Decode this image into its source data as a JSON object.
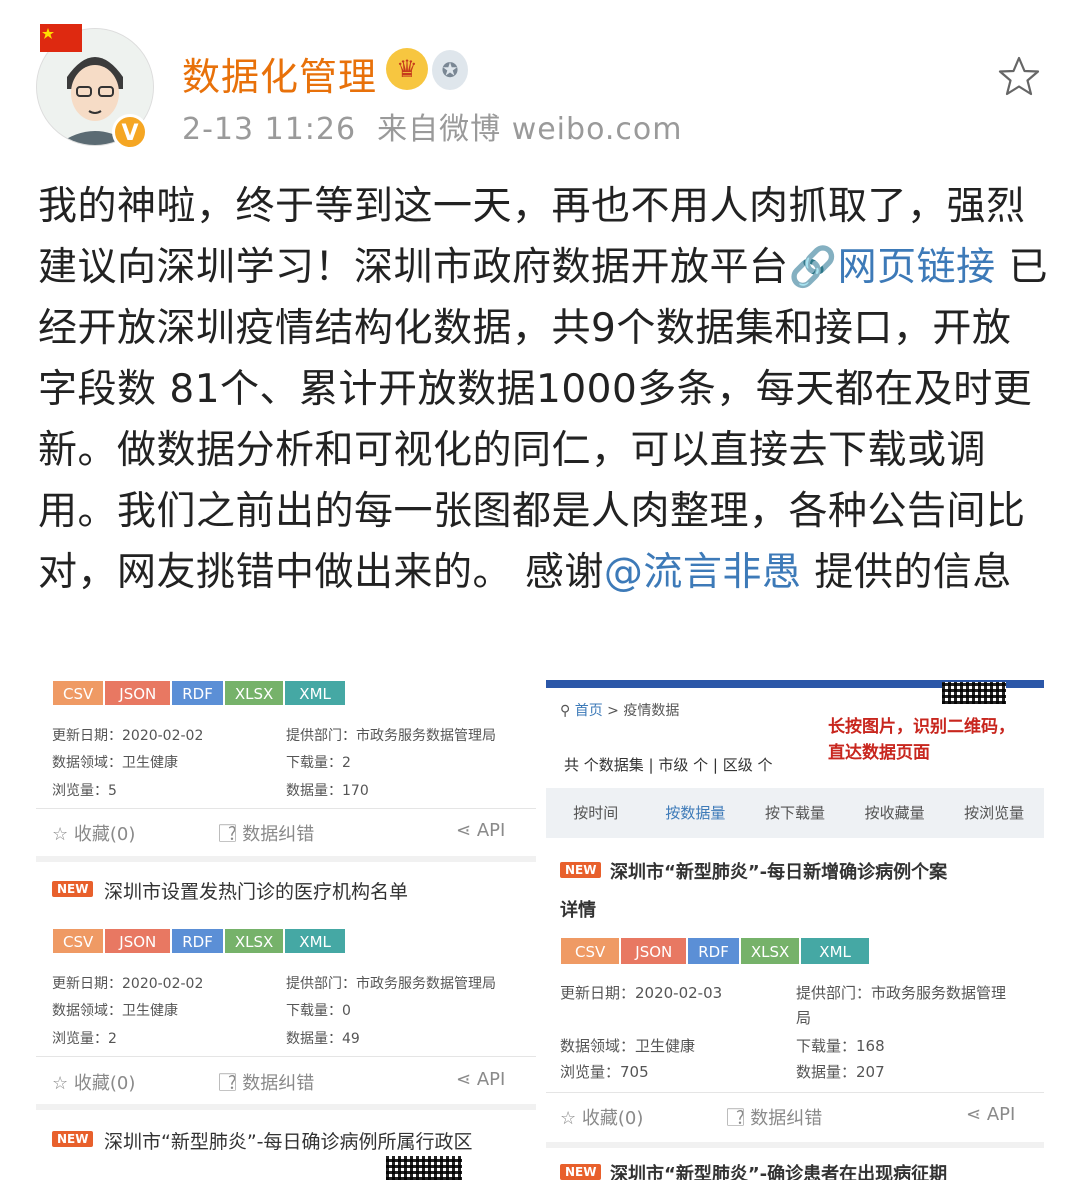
{
  "header": {
    "username": "数据化管理",
    "time": "2-13 11:26",
    "source": "来自微博 weibo.com",
    "verified_badge": "V"
  },
  "post": {
    "text1": "我的神啦，终于等到这一天，再也不用人肉抓取了，强烈建议向深圳学习！深圳市政府数据开放平台",
    "link1": "网页链接",
    "text2": " 已经开放深圳疫情结构化数据，共9个数据集和接口，开放字段数 81个、累计开放数据1000多条，每天都在及时更新。做数据分析和可视化的同仁，可以直接去下载或调用。我们之前出的每一张图都是人肉整理，各种公告间比对，网友挑错中做出来的。 感谢",
    "mention": "@流言非愚",
    "text3": " 提供的信息"
  },
  "left_image": {
    "formats": [
      "CSV",
      "JSON",
      "RDF",
      "XLSX",
      "XML"
    ],
    "card1": {
      "updated": "更新日期：2020-02-02",
      "dept": "提供部门：市政务服务数据管理局",
      "domain": "数据领域：卫生健康",
      "downloads": "下载量：2",
      "views": "浏览量：5",
      "records": "数据量：170"
    },
    "actions": {
      "fav": "收藏(0)",
      "report": "数据纠错",
      "api": "API"
    },
    "new": "NEW",
    "card2_title": "深圳市设置发热门诊的医疗机构名单",
    "card2": {
      "updated": "更新日期：2020-02-02",
      "dept": "提供部门：市政务服务数据管理局",
      "domain": "数据领域：卫生健康",
      "downloads": "下载量：0",
      "views": "浏览量：2",
      "records": "数据量：49"
    },
    "card3_title": "深圳市“新型肺炎”-每日确诊病例所属行政区"
  },
  "right_image": {
    "breadcrumb_home": "首页",
    "breadcrumb_sep": ">",
    "breadcrumb_page": "疫情数据",
    "qr_note_line1": "长按图片，识别二维码，",
    "qr_note_line2": "直达数据页面",
    "counts": "共 个数据集 | 市级 个 | 区级 个",
    "tabs": [
      "按时间",
      "按数据量",
      "按下载量",
      "按收藏量",
      "按浏览量"
    ],
    "card1_title_line1": "深圳市“新型肺炎”-每日新增确诊病例个案",
    "card1_title_line2": "详情",
    "card1": {
      "updated": "更新日期：2020-02-03",
      "dept": "提供部门：市政务服务数据管理",
      "dept2": "局",
      "domain": "数据领域：卫生健康",
      "downloads": "下载量：168",
      "views": "浏览量：705",
      "records": "数据量：207"
    },
    "card2_title": "深圳市“新型肺炎”-确诊患者在出现病征期"
  }
}
